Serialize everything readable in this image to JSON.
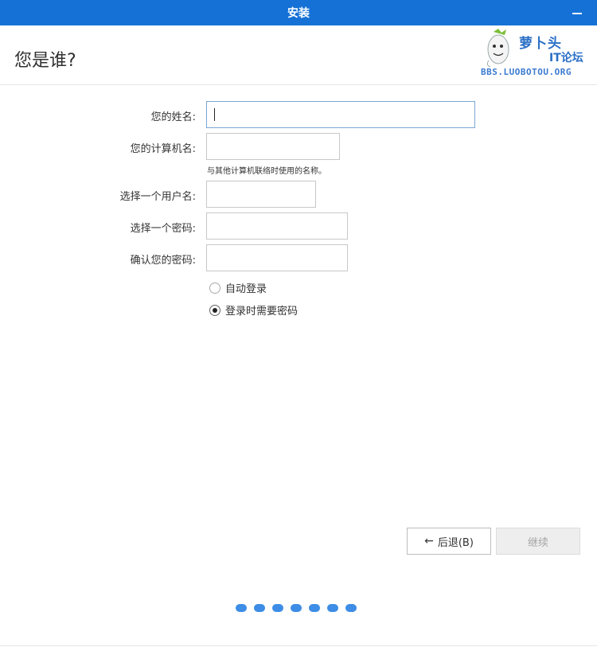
{
  "window": {
    "title": "安装"
  },
  "page": {
    "title": "您是谁?"
  },
  "watermark": {
    "brand": "萝卜头",
    "brand_sub": "IT论坛",
    "url": "BBS.LUOBOTOU.ORG"
  },
  "form": {
    "name_label": "您的姓名:",
    "name_value": "",
    "computer_label": "您的计算机名:",
    "computer_value": "",
    "computer_hint": "与其他计算机联络时使用的名称。",
    "username_label": "选择一个用户名:",
    "username_value": "",
    "password_label": "选择一个密码:",
    "password_value": "",
    "confirm_label": "确认您的密码:",
    "confirm_value": ""
  },
  "login_options": {
    "auto_login": "自动登录",
    "require_password": "登录时需要密码",
    "selected": "require_password"
  },
  "buttons": {
    "back": "后退(B)",
    "continue": "继续"
  },
  "progress": {
    "total_steps": 7
  },
  "colors": {
    "titlebar": "#1571d6",
    "accent": "#3d8de6",
    "disabled_bg": "#eeeeee"
  }
}
